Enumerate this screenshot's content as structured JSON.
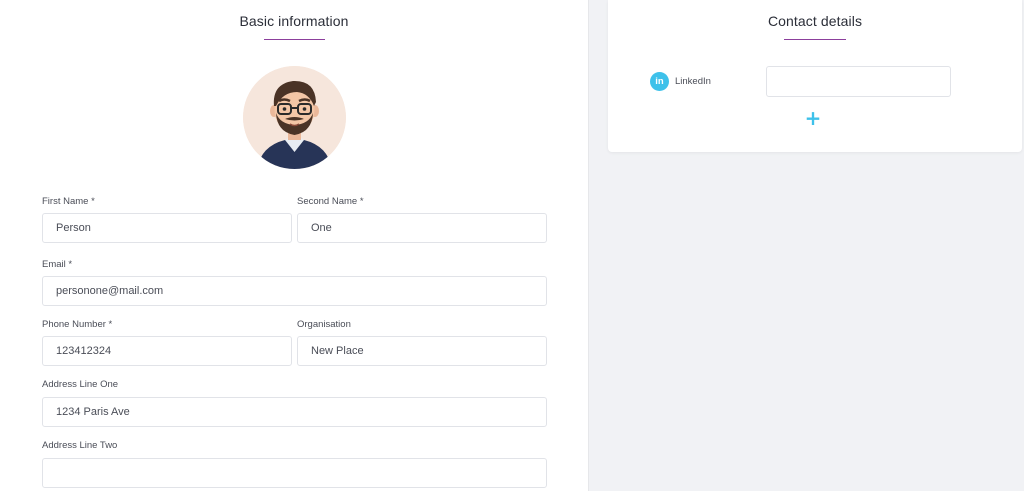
{
  "basic_info": {
    "title": "Basic information",
    "fields": {
      "first_name": {
        "label": "First Name *",
        "value": "Person"
      },
      "second_name": {
        "label": "Second Name *",
        "value": "One"
      },
      "email": {
        "label": "Email *",
        "value": "personone@mail.com"
      },
      "phone": {
        "label": "Phone Number *",
        "value": "123412324"
      },
      "organisation": {
        "label": "Organisation",
        "value": "New Place"
      },
      "address_one": {
        "label": "Address Line One",
        "value": "1234 Paris Ave"
      },
      "address_two": {
        "label": "Address Line Two",
        "value": ""
      }
    }
  },
  "contact_details": {
    "title": "Contact details",
    "linkedin": {
      "icon": "linkedin-icon",
      "icon_text": "in",
      "label": "LinkedIn",
      "value": ""
    },
    "add_button": {
      "icon": "plus-icon",
      "label": "+"
    }
  },
  "colors": {
    "accent_underline": "#8c3f9c",
    "linkedin_blue": "#3ec1ea",
    "background": "#f1f2f5",
    "card": "#ffffff"
  }
}
